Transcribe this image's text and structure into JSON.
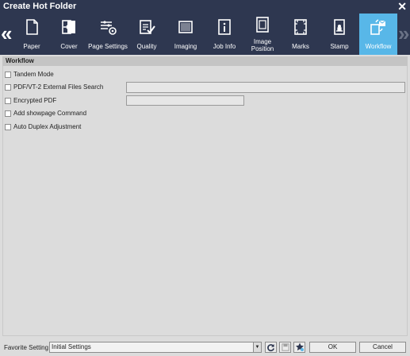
{
  "window": {
    "title": "Create Hot Folder",
    "close_icon": "close-icon"
  },
  "tabs": [
    {
      "label": "Paper",
      "icon": "paper-icon"
    },
    {
      "label": "Cover",
      "icon": "cover-icon"
    },
    {
      "label": "Page Settings",
      "icon": "page-settings-icon"
    },
    {
      "label": "Quality",
      "icon": "quality-icon"
    },
    {
      "label": "Imaging",
      "icon": "imaging-icon"
    },
    {
      "label": "Job Info",
      "icon": "job-info-icon"
    },
    {
      "label_line1": "Image",
      "label_line2": "Position",
      "icon": "image-position-icon"
    },
    {
      "label": "Marks",
      "icon": "marks-icon"
    },
    {
      "label": "Stamp",
      "icon": "stamp-icon"
    },
    {
      "label": "Workflow",
      "icon": "workflow-icon",
      "active": true
    }
  ],
  "nav": {
    "prev": "«",
    "next": "»"
  },
  "section": {
    "title": "Workflow"
  },
  "options": [
    {
      "label": "Tandem Mode",
      "checked": false
    },
    {
      "label": "PDF/VT-2 External Files Search",
      "checked": false,
      "value": ""
    },
    {
      "label": "Encrypted PDF",
      "checked": false,
      "value": ""
    },
    {
      "label": "Add showpage Command",
      "checked": false
    },
    {
      "label": "Auto Duplex Adjustment",
      "checked": false
    }
  ],
  "footer": {
    "favorite_label": "Favorite Setting",
    "favorite_value": "Initial Settings",
    "ok_label": "OK",
    "cancel_label": "Cancel"
  },
  "colors": {
    "titlebar": "#2e3750",
    "active_tab": "#58b7e8",
    "panel": "#dcdcdc"
  }
}
